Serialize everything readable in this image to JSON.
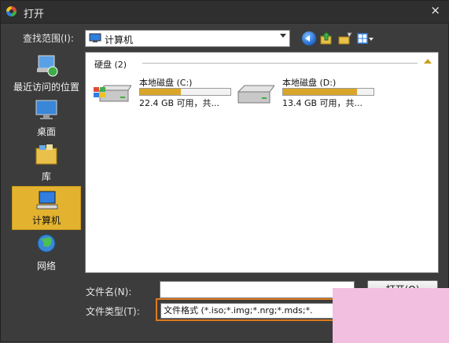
{
  "window": {
    "title": "打开",
    "close_glyph": "×"
  },
  "lookin": {
    "label": "查找范围(I):",
    "value": "计算机"
  },
  "toolbar": {
    "back": "back",
    "up": "up-folder",
    "new_folder": "new-folder",
    "views": "views-menu"
  },
  "places": [
    {
      "label": "最近访问的位置",
      "icon": "recent-places-icon"
    },
    {
      "label": "桌面",
      "icon": "desktop-icon"
    },
    {
      "label": "库",
      "icon": "libraries-icon"
    },
    {
      "label": "计算机",
      "icon": "computer-icon",
      "selected": true
    },
    {
      "label": "网络",
      "icon": "network-icon"
    }
  ],
  "filelist": {
    "group_header": "硬盘 (2)",
    "drives": [
      {
        "name": "本地磁盘 (C:)",
        "space": "22.4 GB 可用，共...",
        "fill": 0.45,
        "icon": "windows-drive-icon"
      },
      {
        "name": "本地磁盘 (D:)",
        "space": "13.4 GB 可用，共...",
        "fill": 0.82,
        "icon": "hard-drive-icon"
      }
    ]
  },
  "filename": {
    "label": "文件名(N):",
    "value": ""
  },
  "filetype": {
    "label": "文件类型(T):",
    "value": "文件格式 (*.iso;*.img;*.nrg;*.mds;*."
  },
  "buttons": {
    "open": "打开(O)"
  },
  "colors": {
    "selection": "#e3b330",
    "drive_bar": "#d9a62a",
    "highlight": "#e07b1e",
    "overlay": "#f3bfe0"
  }
}
